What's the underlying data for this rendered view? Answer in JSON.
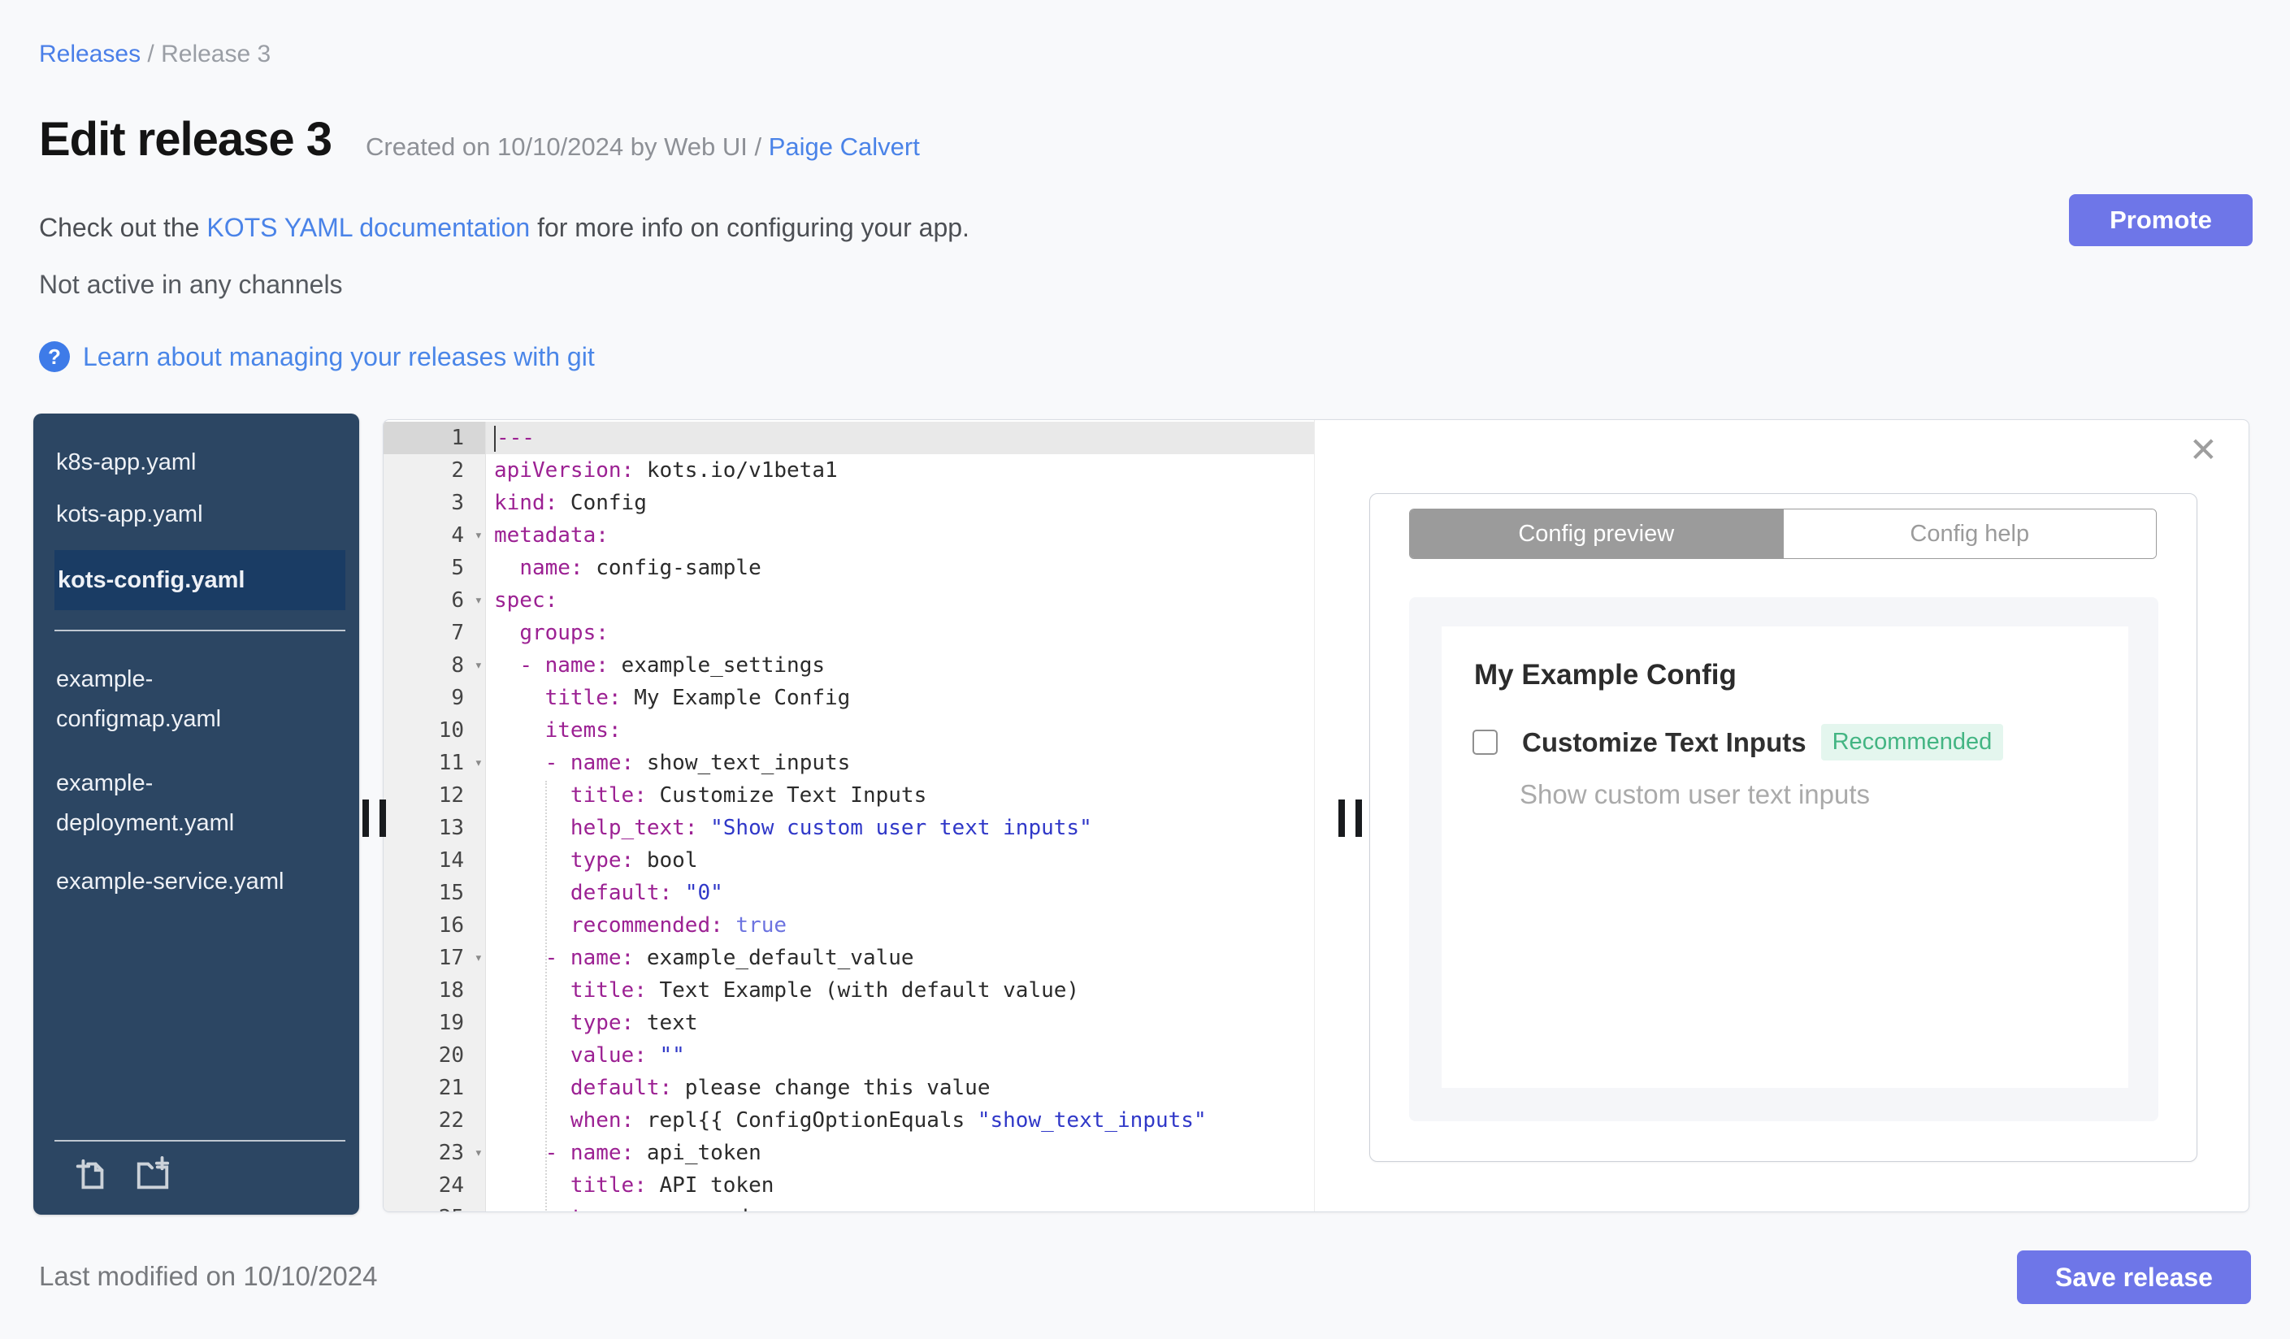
{
  "colors": {
    "accent_button": "#6e76e8",
    "link_blue": "#4a83e8",
    "sidebar_navy": "#2c4663",
    "sidebar_selected": "#1a3c64",
    "code_key": "#9c2193",
    "code_string": "#3038c8",
    "code_boolean": "#6d74e0",
    "recommended_green": "#43b583",
    "recommended_bg": "#e4f6ee"
  },
  "breadcrumb": {
    "link": "Releases",
    "separator": " / ",
    "current": "Release 3"
  },
  "header": {
    "title": "Edit release 3",
    "created_prefix": "Created on 10/10/2024 by Web UI / ",
    "created_link": "Paige Calvert",
    "promote_label": "Promote"
  },
  "info": {
    "docs_prefix": "Check out the ",
    "docs_link": "KOTS YAML documentation",
    "docs_suffix": " for more info on configuring your app.",
    "channel_status": "Not active in any channels",
    "help_icon": "?",
    "git_link": "Learn about managing your releases with git"
  },
  "file_tree": {
    "group_top": [
      {
        "label": "k8s-app.yaml",
        "selected": false
      },
      {
        "label": "kots-app.yaml",
        "selected": false
      },
      {
        "label": "kots-config.yaml",
        "selected": true
      }
    ],
    "group_bottom": [
      {
        "label": "example-configmap.yaml",
        "selected": false,
        "wrap": [
          "example-",
          "configmap.yaml"
        ]
      },
      {
        "label": "example-deployment.yaml",
        "selected": false,
        "wrap": [
          "example-",
          "deployment.yaml"
        ]
      },
      {
        "label": "example-service.yaml",
        "selected": false
      }
    ]
  },
  "editor": {
    "fold_icon": "▾",
    "active_line": 1,
    "lines": [
      {
        "active": true,
        "cursor": true,
        "fold": false,
        "parts": [
          [
            "k",
            "---"
          ]
        ]
      },
      {
        "fold": false,
        "parts": [
          [
            "k",
            "apiVersion:"
          ],
          [
            "v",
            " kots.io/v1beta1"
          ]
        ]
      },
      {
        "fold": false,
        "parts": [
          [
            "k",
            "kind:"
          ],
          [
            "v",
            " Config"
          ]
        ]
      },
      {
        "fold": true,
        "parts": [
          [
            "k",
            "metadata:"
          ]
        ]
      },
      {
        "fold": false,
        "parts": [
          [
            "v",
            "  "
          ],
          [
            "k",
            "name:"
          ],
          [
            "v",
            " config-sample"
          ]
        ]
      },
      {
        "fold": true,
        "parts": [
          [
            "k",
            "spec:"
          ]
        ]
      },
      {
        "fold": false,
        "parts": [
          [
            "v",
            "  "
          ],
          [
            "k",
            "groups:"
          ]
        ]
      },
      {
        "fold": true,
        "parts": [
          [
            "v",
            "  "
          ],
          [
            "k",
            "- name:"
          ],
          [
            "v",
            " example_settings"
          ]
        ]
      },
      {
        "fold": false,
        "parts": [
          [
            "v",
            "    "
          ],
          [
            "k",
            "title:"
          ],
          [
            "v",
            " My Example Config"
          ]
        ]
      },
      {
        "fold": false,
        "parts": [
          [
            "v",
            "    "
          ],
          [
            "k",
            "items:"
          ]
        ]
      },
      {
        "fold": true,
        "parts": [
          [
            "v",
            "    "
          ],
          [
            "k",
            "- name:"
          ],
          [
            "v",
            " show_text_inputs"
          ]
        ]
      },
      {
        "fold": false,
        "parts": [
          [
            "v",
            "      "
          ],
          [
            "k",
            "title:"
          ],
          [
            "v",
            " Customize Text Inputs"
          ]
        ]
      },
      {
        "fold": false,
        "parts": [
          [
            "v",
            "      "
          ],
          [
            "k",
            "help_text:"
          ],
          [
            "v",
            " "
          ],
          [
            "s",
            "\"Show custom user text inputs\""
          ]
        ]
      },
      {
        "fold": false,
        "parts": [
          [
            "v",
            "      "
          ],
          [
            "k",
            "type:"
          ],
          [
            "v",
            " bool"
          ]
        ]
      },
      {
        "fold": false,
        "parts": [
          [
            "v",
            "      "
          ],
          [
            "k",
            "default:"
          ],
          [
            "v",
            " "
          ],
          [
            "s",
            "\"0\""
          ]
        ]
      },
      {
        "fold": false,
        "parts": [
          [
            "v",
            "      "
          ],
          [
            "k",
            "recommended:"
          ],
          [
            "v",
            " "
          ],
          [
            "b",
            "true"
          ]
        ]
      },
      {
        "fold": true,
        "parts": [
          [
            "v",
            "    "
          ],
          [
            "k",
            "- name:"
          ],
          [
            "v",
            " example_default_value"
          ]
        ]
      },
      {
        "fold": false,
        "parts": [
          [
            "v",
            "      "
          ],
          [
            "k",
            "title:"
          ],
          [
            "v",
            " Text Example (with default value)"
          ]
        ]
      },
      {
        "fold": false,
        "parts": [
          [
            "v",
            "      "
          ],
          [
            "k",
            "type:"
          ],
          [
            "v",
            " text"
          ]
        ]
      },
      {
        "fold": false,
        "parts": [
          [
            "v",
            "      "
          ],
          [
            "k",
            "value:"
          ],
          [
            "v",
            " "
          ],
          [
            "s",
            "\"\""
          ]
        ]
      },
      {
        "fold": false,
        "parts": [
          [
            "v",
            "      "
          ],
          [
            "k",
            "default:"
          ],
          [
            "v",
            " please change this value"
          ]
        ]
      },
      {
        "fold": false,
        "parts": [
          [
            "v",
            "      "
          ],
          [
            "k",
            "when:"
          ],
          [
            "v",
            " repl{{ ConfigOptionEquals "
          ],
          [
            "s",
            "\"show_text_inputs\""
          ]
        ]
      },
      {
        "fold": true,
        "parts": [
          [
            "v",
            "    "
          ],
          [
            "k",
            "- name:"
          ],
          [
            "v",
            " api_token"
          ]
        ]
      },
      {
        "fold": false,
        "parts": [
          [
            "v",
            "      "
          ],
          [
            "k",
            "title:"
          ],
          [
            "v",
            " API token"
          ]
        ]
      },
      {
        "fold": false,
        "parts": [
          [
            "v",
            "      "
          ],
          [
            "k",
            "type:"
          ],
          [
            "v",
            " password"
          ]
        ]
      }
    ]
  },
  "preview": {
    "close_icon": "✕",
    "tabs": [
      {
        "label": "Config preview",
        "active": true
      },
      {
        "label": "Config help",
        "active": false
      }
    ],
    "card": {
      "title": "My Example Config",
      "checkbox_label": "Customize Text Inputs",
      "badge": "Recommended",
      "help_text": "Show custom user text inputs"
    }
  },
  "footer": {
    "last_modified": "Last modified on 10/10/2024",
    "save_label": "Save release"
  }
}
